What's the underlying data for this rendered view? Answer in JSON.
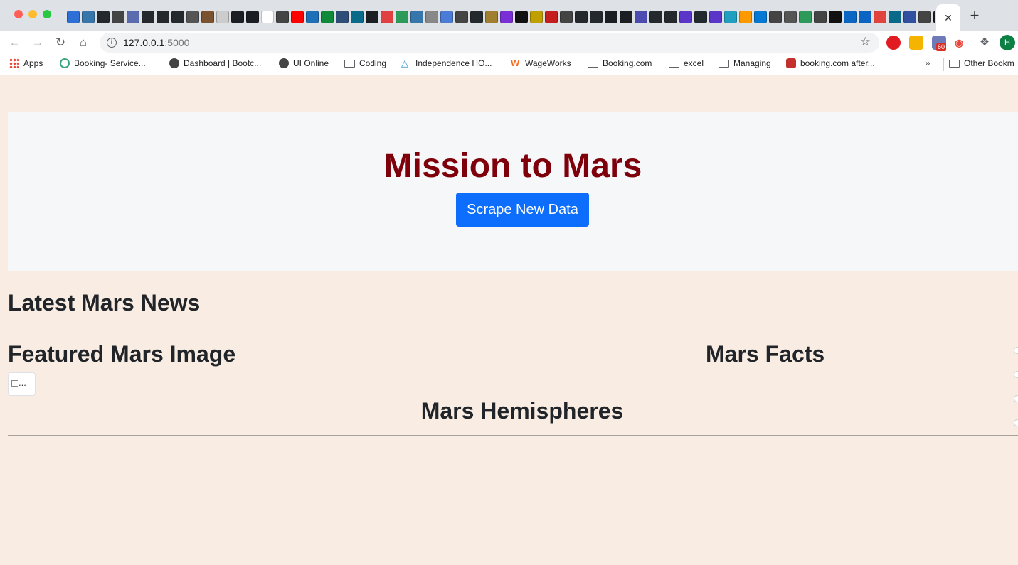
{
  "browser": {
    "url_host": "127.0.0.1",
    "url_port": ":5000",
    "active_tab_close": "✕",
    "new_tab": "+",
    "profile_initial": "H",
    "extension_badge": "60",
    "favicon_colors": [
      "#2e6fd6",
      "#3776ab",
      "#24292e",
      "#444444",
      "#5b6bb0",
      "#24292e",
      "#24292e",
      "#24292e",
      "#555555",
      "#7a5230",
      "#cccccc",
      "#1b1f23",
      "#1b1f23",
      "#ffffff",
      "#444444",
      "#ff0000",
      "#1d6fb8",
      "#0f8a3a",
      "#2e4e78",
      "#0a6a8a",
      "#1b1f23",
      "#e04040",
      "#2e9a5a",
      "#3776ab",
      "#888888",
      "#4a7bd6",
      "#444444",
      "#24292e",
      "#a08030",
      "#7a2fd6",
      "#111111",
      "#c0a000",
      "#c41e1e",
      "#444444",
      "#24292e",
      "#24292e",
      "#1b1f23",
      "#1b1f23",
      "#4b4bb0",
      "#24292e",
      "#24292e",
      "#5a35c8",
      "#24292e",
      "#5a35c8",
      "#1fa0c0",
      "#ff9900",
      "#0078d4",
      "#444444",
      "#555555",
      "#2e9a5a",
      "#444444",
      "#111111",
      "#0a66c2",
      "#0a66c2",
      "#e0443c",
      "#0a6a8a",
      "#3050a0",
      "#444444",
      "#1b1f23"
    ]
  },
  "bookmarks": {
    "items": [
      {
        "label": "Apps"
      },
      {
        "label": "Booking- Service..."
      },
      {
        "label": "Dashboard | Bootc..."
      },
      {
        "label": "UI Online"
      },
      {
        "label": "Coding"
      },
      {
        "label": "Independence HO..."
      },
      {
        "label": "WageWorks"
      },
      {
        "label": "Booking.com"
      },
      {
        "label": "excel"
      },
      {
        "label": "Managing"
      },
      {
        "label": "booking.com after..."
      }
    ],
    "overflow": "»",
    "other": "Other Bookm"
  },
  "page": {
    "title": "Mission to Mars",
    "scrape_button": "Scrape New Data",
    "news_heading": "Latest Mars News",
    "featured_heading": "Featured Mars Image",
    "featured_image_alt": "...",
    "facts_heading": "Mars Facts",
    "hemispheres_heading": "Mars Hemispheres"
  },
  "colors": {
    "page_background": "#f9ede3",
    "title": "#7e000a",
    "button": "#0d6efd"
  }
}
